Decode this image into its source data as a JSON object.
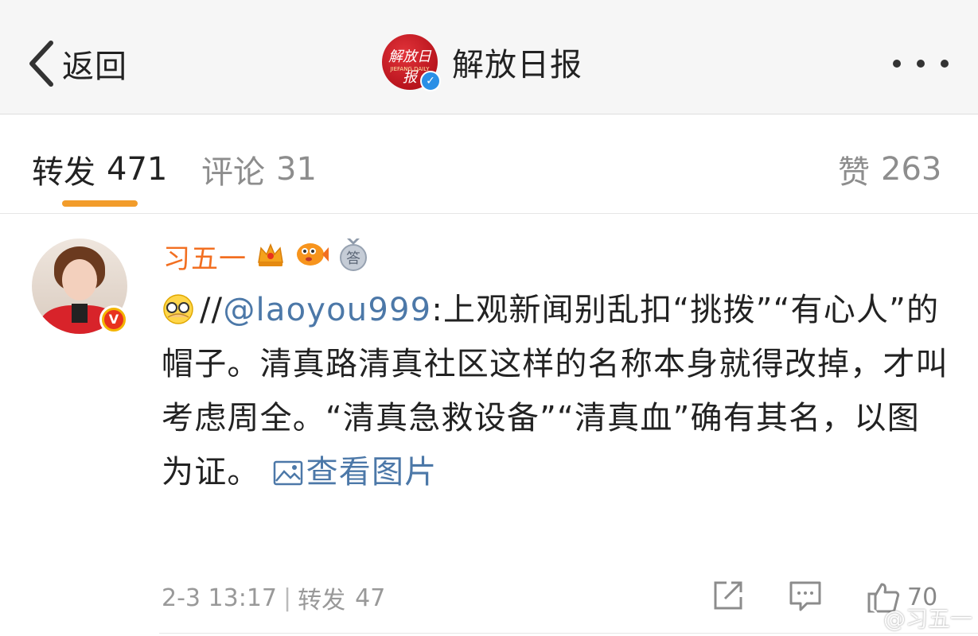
{
  "header": {
    "back_label": "返回",
    "title": "解放日报",
    "logo_text": "解放日报",
    "logo_sub": "JIEFANG DAILY"
  },
  "tabs": {
    "forward": {
      "label": "转发",
      "count": "471"
    },
    "comment": {
      "label": "评论",
      "count": "31"
    },
    "like": {
      "label": "赞",
      "count": "263"
    }
  },
  "post": {
    "username": "习五一",
    "badge_answer": "答",
    "slashes": "//",
    "mention": "@laoyou999",
    "text": ":上观新闻别乱扣“挑拨”“有心人”的帽子。清真路清真社区这样的名称本身就得改掉，才叫考虑周全。“清真急救设备”“清真血”确有其名，以图为证。",
    "view_pic": "查看图片",
    "time": "2-3 13:17",
    "forward_label": "转发",
    "forward_count": "47",
    "like_count": "70"
  },
  "watermark": {
    "text": "@习五一"
  },
  "colors": {
    "accent_orange": "#f29c2b",
    "username": "#f26f21",
    "link": "#4c78a8",
    "header_bg": "#f6f6f6"
  },
  "icons": [
    "chevron-left-icon",
    "verified-icon",
    "more-icon",
    "crown-icon",
    "fish-icon",
    "answer-medal-icon",
    "facepalm-emoji-icon",
    "picture-icon",
    "share-icon",
    "comment-icon",
    "thumbs-up-icon",
    "weibo-icon"
  ]
}
